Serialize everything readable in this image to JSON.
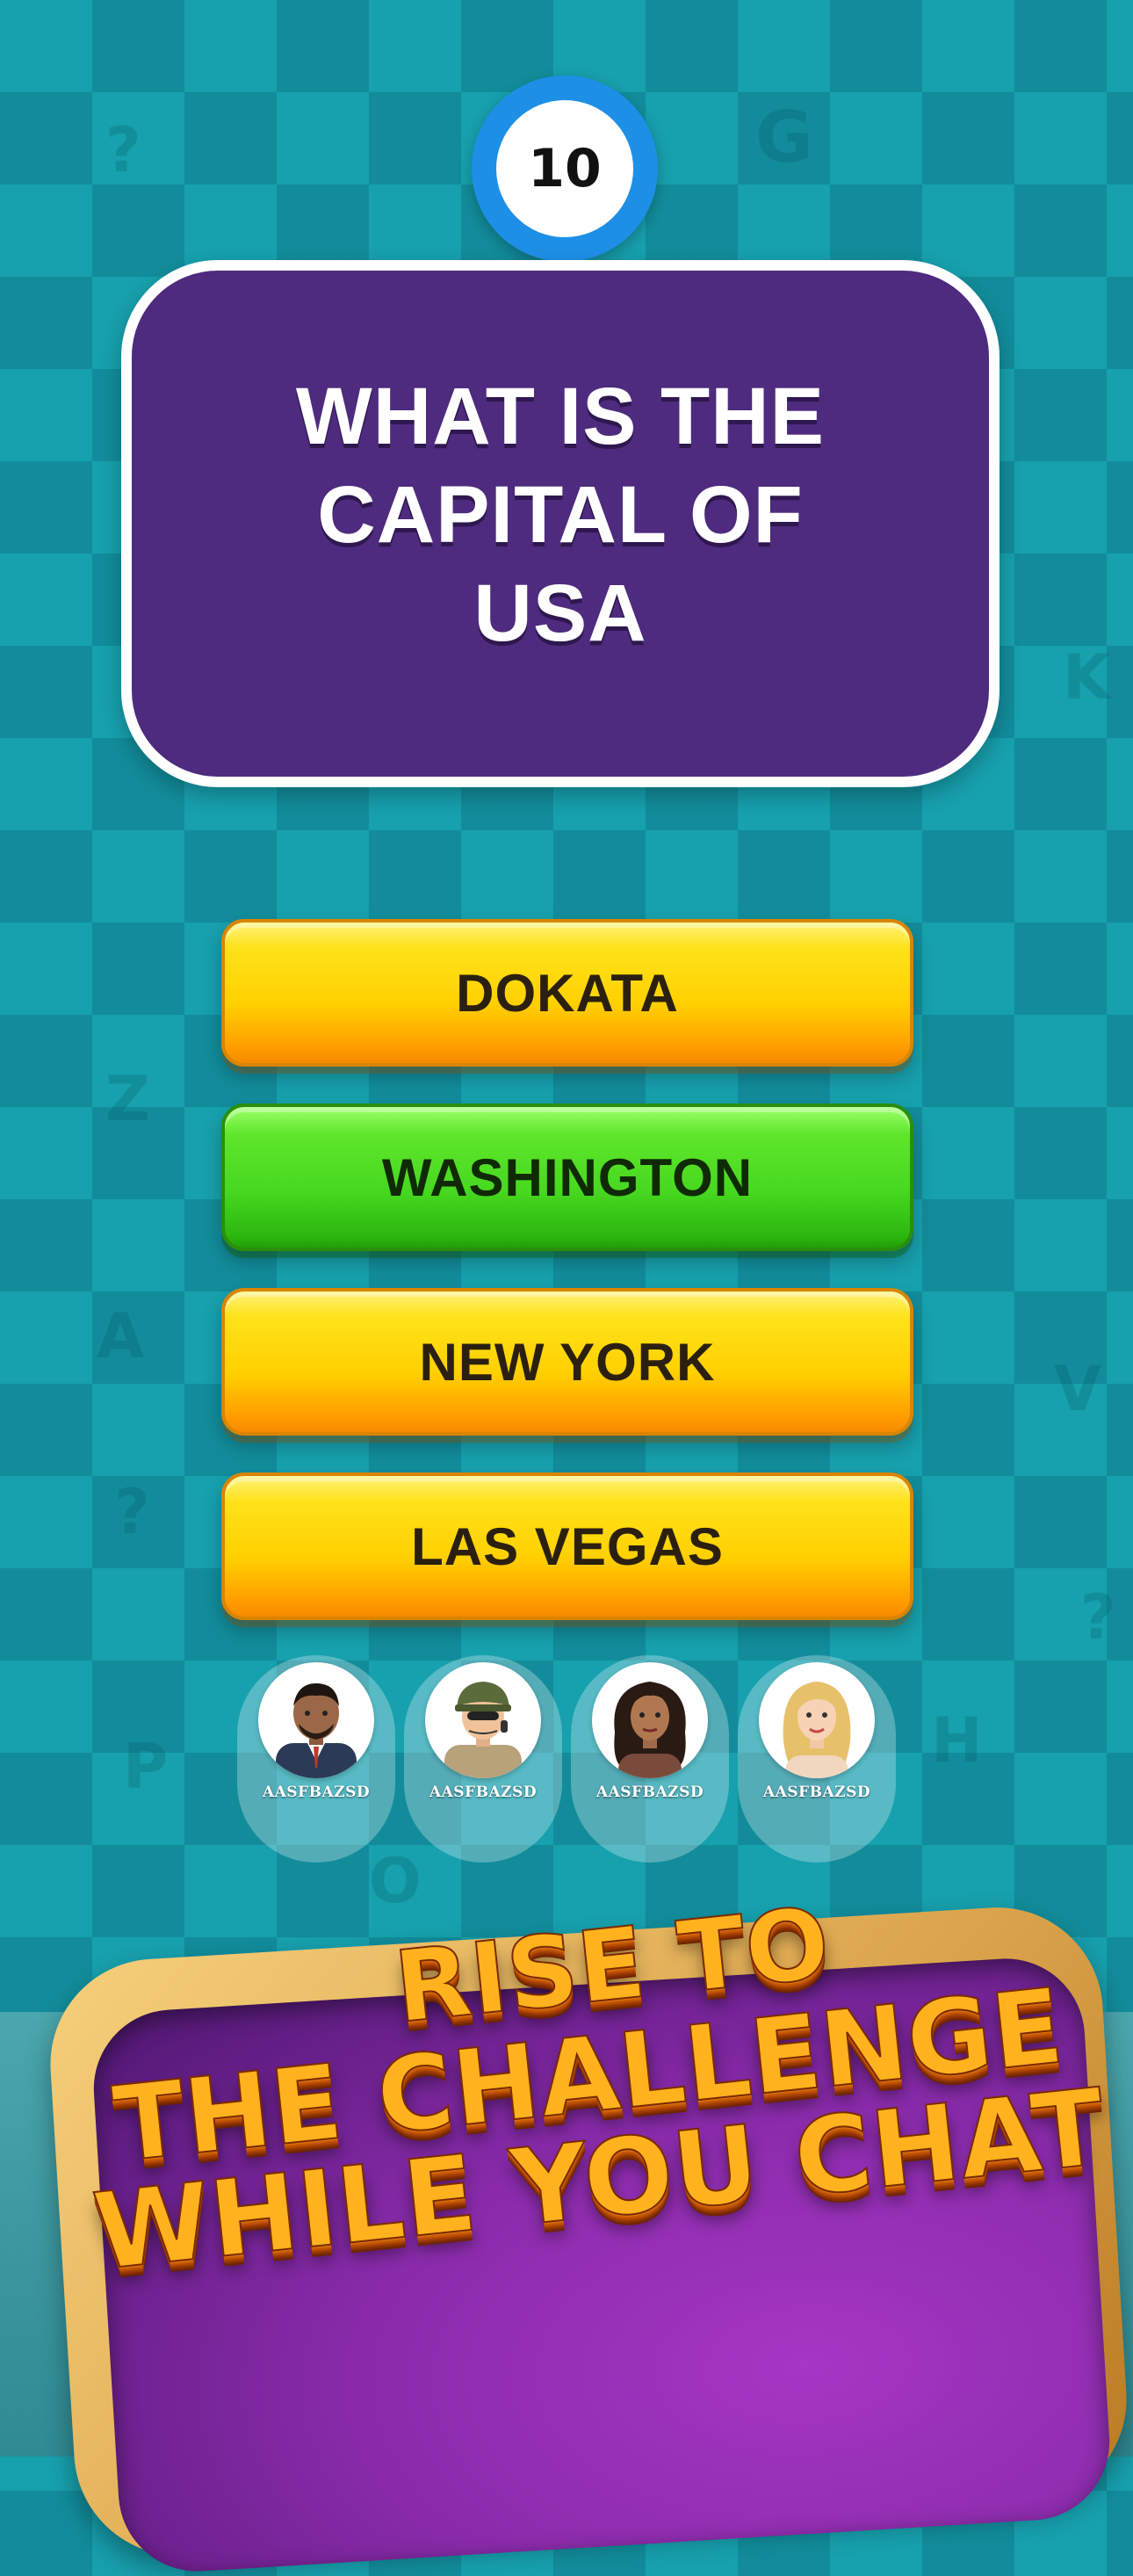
{
  "timer": {
    "value": "10"
  },
  "question": {
    "text": "WHAT IS THE CAPITAL OF USA"
  },
  "answers": [
    {
      "label": "DOKATA",
      "state": "default",
      "color": "#ffd000"
    },
    {
      "label": "WASHINGTON",
      "state": "correct",
      "color": "#47d820"
    },
    {
      "label": "NEW YORK",
      "state": "default",
      "color": "#ffd000"
    },
    {
      "label": "LAS VEGAS",
      "state": "default",
      "color": "#ffd000"
    }
  ],
  "players": [
    {
      "name": "AASFBAZSD",
      "avatar": "man-suit-avatar-icon"
    },
    {
      "name": "AASFBAZSD",
      "avatar": "soldier-avatar-icon"
    },
    {
      "name": "AASFBAZSD",
      "avatar": "curly-hair-woman-avatar-icon"
    },
    {
      "name": "AASFBAZSD",
      "avatar": "blonde-woman-avatar-icon"
    }
  ],
  "banner": {
    "line1": "RISE TO",
    "line2": "THE CHALLENGE",
    "line3": "WHILE YOU CHAT"
  },
  "colors": {
    "background": "#17a0ad",
    "question_panel": "#4e2b7e",
    "timer_ring": "#1e8fe6",
    "banner_text": "#ffb21e",
    "banner_panel": "#8a2bab"
  }
}
